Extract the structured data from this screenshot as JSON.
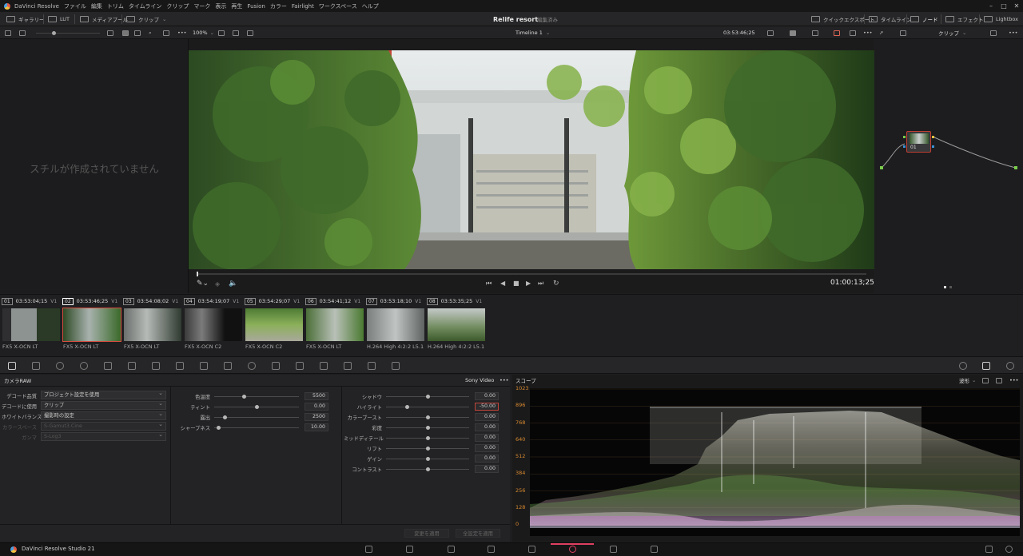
{
  "app": {
    "title": "DaVinci Resolve",
    "menu": [
      "ファイル",
      "編集",
      "トリム",
      "タイムライン",
      "クリップ",
      "マーク",
      "表示",
      "再生",
      "Fusion",
      "カラー",
      "Fairlight",
      "ワークスペース",
      "ヘルプ"
    ],
    "window_controls": [
      "–",
      "□",
      "✕"
    ]
  },
  "toolbar": {
    "gallery": "ギャラリー",
    "lut": "LUT",
    "media_pool": "メディアプール",
    "clips": "クリップ",
    "project_name": "Relife resort",
    "project_status": "編集済み",
    "quick_export": "クイックエクスポート",
    "timeline": "タイムライン",
    "nodes": "ノード",
    "effects": "エフェクト",
    "lightbox": "Lightbox"
  },
  "subbar": {
    "zoom": "100%",
    "timeline_name": "Timeline 1",
    "timecode": "03:53:46;25",
    "node_mode": "クリップ"
  },
  "gallery": {
    "empty_message": "スチルが作成されていません"
  },
  "viewer": {
    "timecode": "01:00:13;25",
    "progress": 0.0
  },
  "node": {
    "label": "01"
  },
  "clips": [
    {
      "num": "01",
      "tc": "03:53:04;15",
      "track": "V1",
      "name": "FX5 X-OCN LT",
      "selected": false
    },
    {
      "num": "02",
      "tc": "03:53:46;25",
      "track": "V1",
      "name": "FX5 X-OCN LT",
      "selected": true
    },
    {
      "num": "03",
      "tc": "03:54:08;02",
      "track": "V1",
      "name": "FX5 X-OCN LT",
      "selected": false
    },
    {
      "num": "04",
      "tc": "03:54:19;07",
      "track": "V1",
      "name": "FX5 X-OCN C2",
      "selected": false
    },
    {
      "num": "05",
      "tc": "03:54:29;07",
      "track": "V1",
      "name": "FX5 X-OCN C2",
      "selected": false
    },
    {
      "num": "06",
      "tc": "03:54:41;12",
      "track": "V1",
      "name": "FX5 X-OCN LT",
      "selected": false
    },
    {
      "num": "07",
      "tc": "03:53:18;10",
      "track": "V1",
      "name": "H.264 High 4:2:2 L5.1",
      "selected": false
    },
    {
      "num": "08",
      "tc": "03:53:35;25",
      "track": "V1",
      "name": "H.264 High 4:2:2 L5.1",
      "selected": false
    }
  ],
  "camera_raw": {
    "title": "カメラRAW",
    "format": "Sony Video",
    "decode_quality_label": "デコード品質",
    "decode_quality_value": "プロジェクト設定を使用",
    "decode_using_label": "デコードに使用",
    "decode_using_value": "クリップ",
    "white_balance_label": "ホワイトバランス",
    "white_balance_value": "撮影時の設定",
    "color_space_label": "カラースペース",
    "color_space_value": "S-Gamut3.Cine",
    "gamma_label": "ガンマ",
    "gamma_value": "S-Log3",
    "sliders_mid": [
      {
        "label": "色温度",
        "value": "5500",
        "pos": 0.35
      },
      {
        "label": "ティント",
        "value": "0.00",
        "pos": 0.5
      },
      {
        "label": "露出",
        "value": "2500",
        "pos": 0.12
      },
      {
        "label": "シャープネス",
        "value": "10.00",
        "pos": 0.05
      }
    ],
    "sliders_right": [
      {
        "label": "シャドウ",
        "value": "0.00",
        "pos": 0.5
      },
      {
        "label": "ハイライト",
        "value": "-50.00",
        "pos": 0.25,
        "active": true
      },
      {
        "label": "カラーブースト",
        "value": "0.00",
        "pos": 0.5
      },
      {
        "label": "彩度",
        "value": "0.00",
        "pos": 0.5
      },
      {
        "label": "ミッドディテール",
        "value": "0.00",
        "pos": 0.5
      },
      {
        "label": "リフト",
        "value": "0.00",
        "pos": 0.5
      },
      {
        "label": "ゲイン",
        "value": "0.00",
        "pos": 0.5
      },
      {
        "label": "コントラスト",
        "value": "0.00",
        "pos": 0.5
      }
    ],
    "apply_changes": "変更を適用",
    "apply_all": "全設定を適用"
  },
  "scope": {
    "title": "スコープ",
    "mode": "波形",
    "ticks": [
      "1023",
      "896",
      "768",
      "640",
      "512",
      "384",
      "256",
      "128",
      "0"
    ],
    "accent_color": "#d98a2e"
  },
  "bottom": {
    "app_name": "DaVinci Resolve Studio 21"
  }
}
